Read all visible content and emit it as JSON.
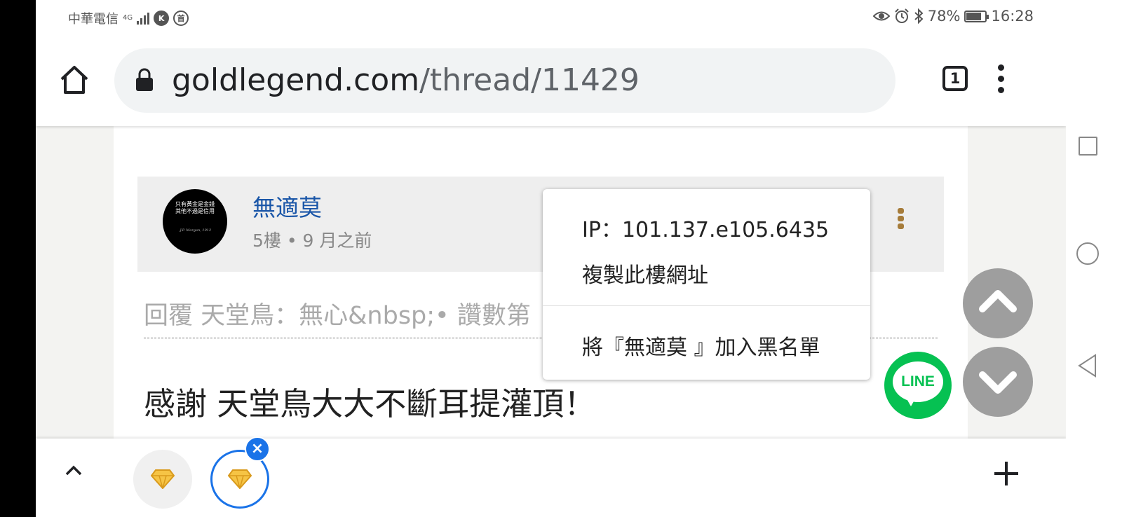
{
  "status_bar": {
    "carrier": "中華電信",
    "network": "4G",
    "app_icon_1": "K",
    "app_icon_2": "首",
    "battery": "78%",
    "time": "16:28",
    "icons": [
      "eye-icon",
      "alarm-icon",
      "bluetooth-icon",
      "battery-icon"
    ]
  },
  "browser": {
    "url_domain": "goldlegend.com",
    "url_path": "/thread/11429",
    "tab_count": "1",
    "icons": [
      "home-icon",
      "lock-icon",
      "tab-switcher-icon",
      "menu-icon"
    ]
  },
  "post": {
    "username": "無適莫",
    "floor_time": "5樓 • 9 月之前",
    "reply_line": "回覆 天堂鳥：無心&nbsp;• 讚數第",
    "body": "感謝 天堂鳥大大不斷耳提灌頂！",
    "avatar_lines": [
      "只有黃金是金錢",
      "其他不過是信用",
      "-J.P. Morgan, 1912"
    ]
  },
  "popup_menu": {
    "ip": "IP：101.137.e105.6435",
    "copy_link": "複製此樓網址",
    "blacklist": "將『無適莫 』加入黑名單"
  },
  "floating": {
    "line_label": "LINE",
    "icons": [
      "scroll-up-icon",
      "scroll-down-icon"
    ]
  },
  "bottom_bar": {
    "icons": [
      "chevron-up-icon",
      "diamond-icon",
      "close-icon",
      "plus-icon"
    ]
  },
  "colors": {
    "username": "#1a56a8",
    "line_green": "#06c152",
    "tab_active": "#1a73e8",
    "more_menu": "#a67c3a"
  }
}
